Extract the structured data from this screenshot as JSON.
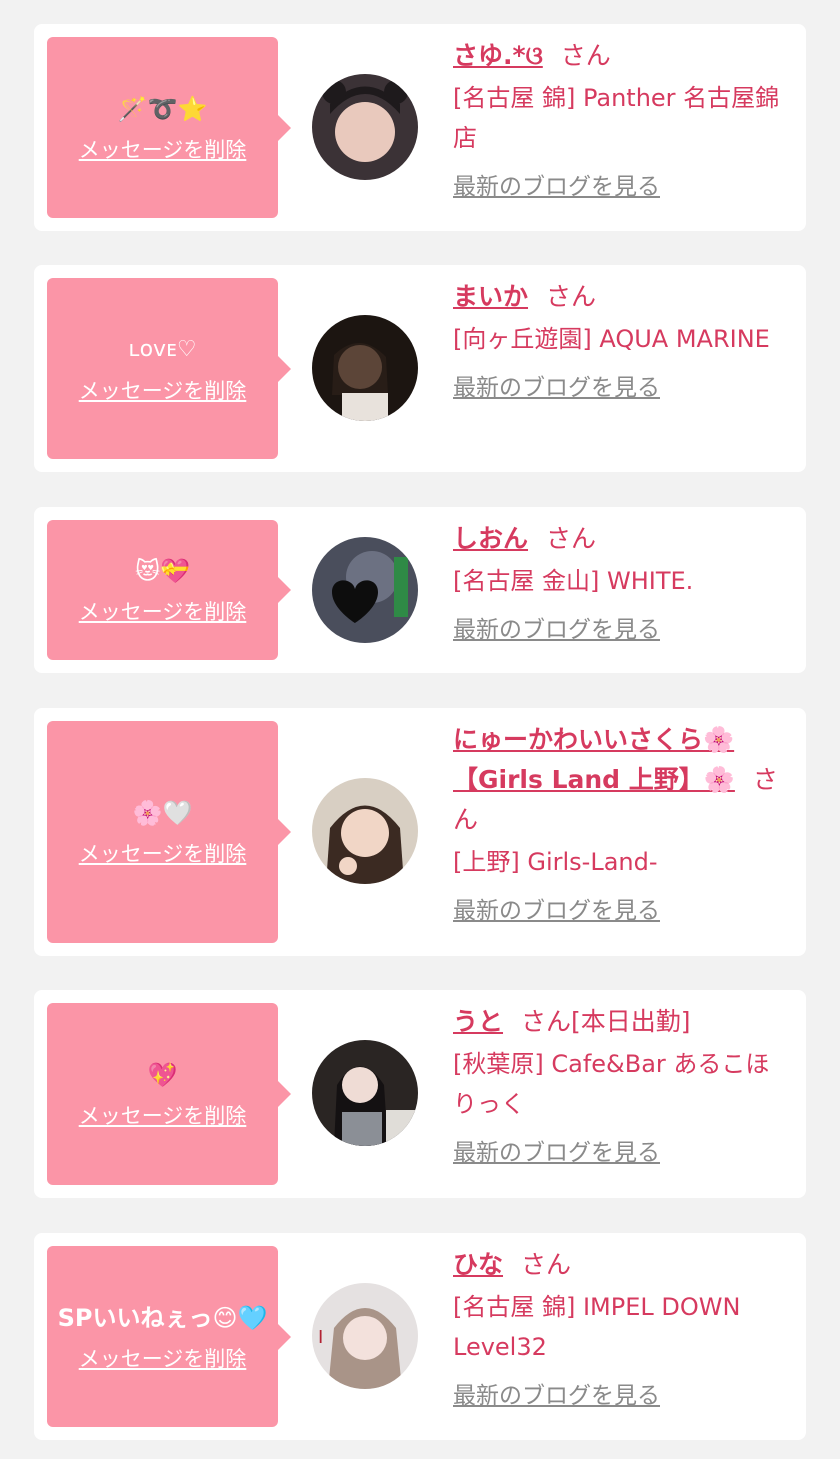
{
  "common": {
    "delete_label": "メッセージを削除",
    "san_label": "さん",
    "blog_label": "最新のブログを見る"
  },
  "cards": [
    {
      "message": "🪄➰⭐️",
      "name": "さゆ.*ଓ",
      "status": "",
      "shop": "[名古屋 錦] Panther 名古屋錦店"
    },
    {
      "message": "ʟᴏᴠᴇ♡",
      "name": "まいか",
      "status": "",
      "shop": "[向ヶ丘遊園] AQUA MARINE"
    },
    {
      "message": "😻💝",
      "name": "しおん",
      "status": "",
      "shop": "[名古屋 金山] WHITE."
    },
    {
      "message": "🌸🤍",
      "name": "にゅーかわいいさくら🌸【Girls Land 上野】🌸",
      "status": "",
      "shop": "[上野] Girls-Land-"
    },
    {
      "message": "💖",
      "name": "うと",
      "status": "[本日出勤]",
      "shop": "[秋葉原] Cafe&Bar あるこほりっく"
    },
    {
      "message": "SPいいねぇっ😊🩵",
      "name": "ひな",
      "status": "",
      "shop": "[名古屋 錦] IMPEL DOWN Level32"
    }
  ],
  "colors": {
    "bubble": "#fb95a7",
    "name": "#d63a5f",
    "blog_link": "#8a8a8a",
    "background": "#f2f2f2"
  }
}
